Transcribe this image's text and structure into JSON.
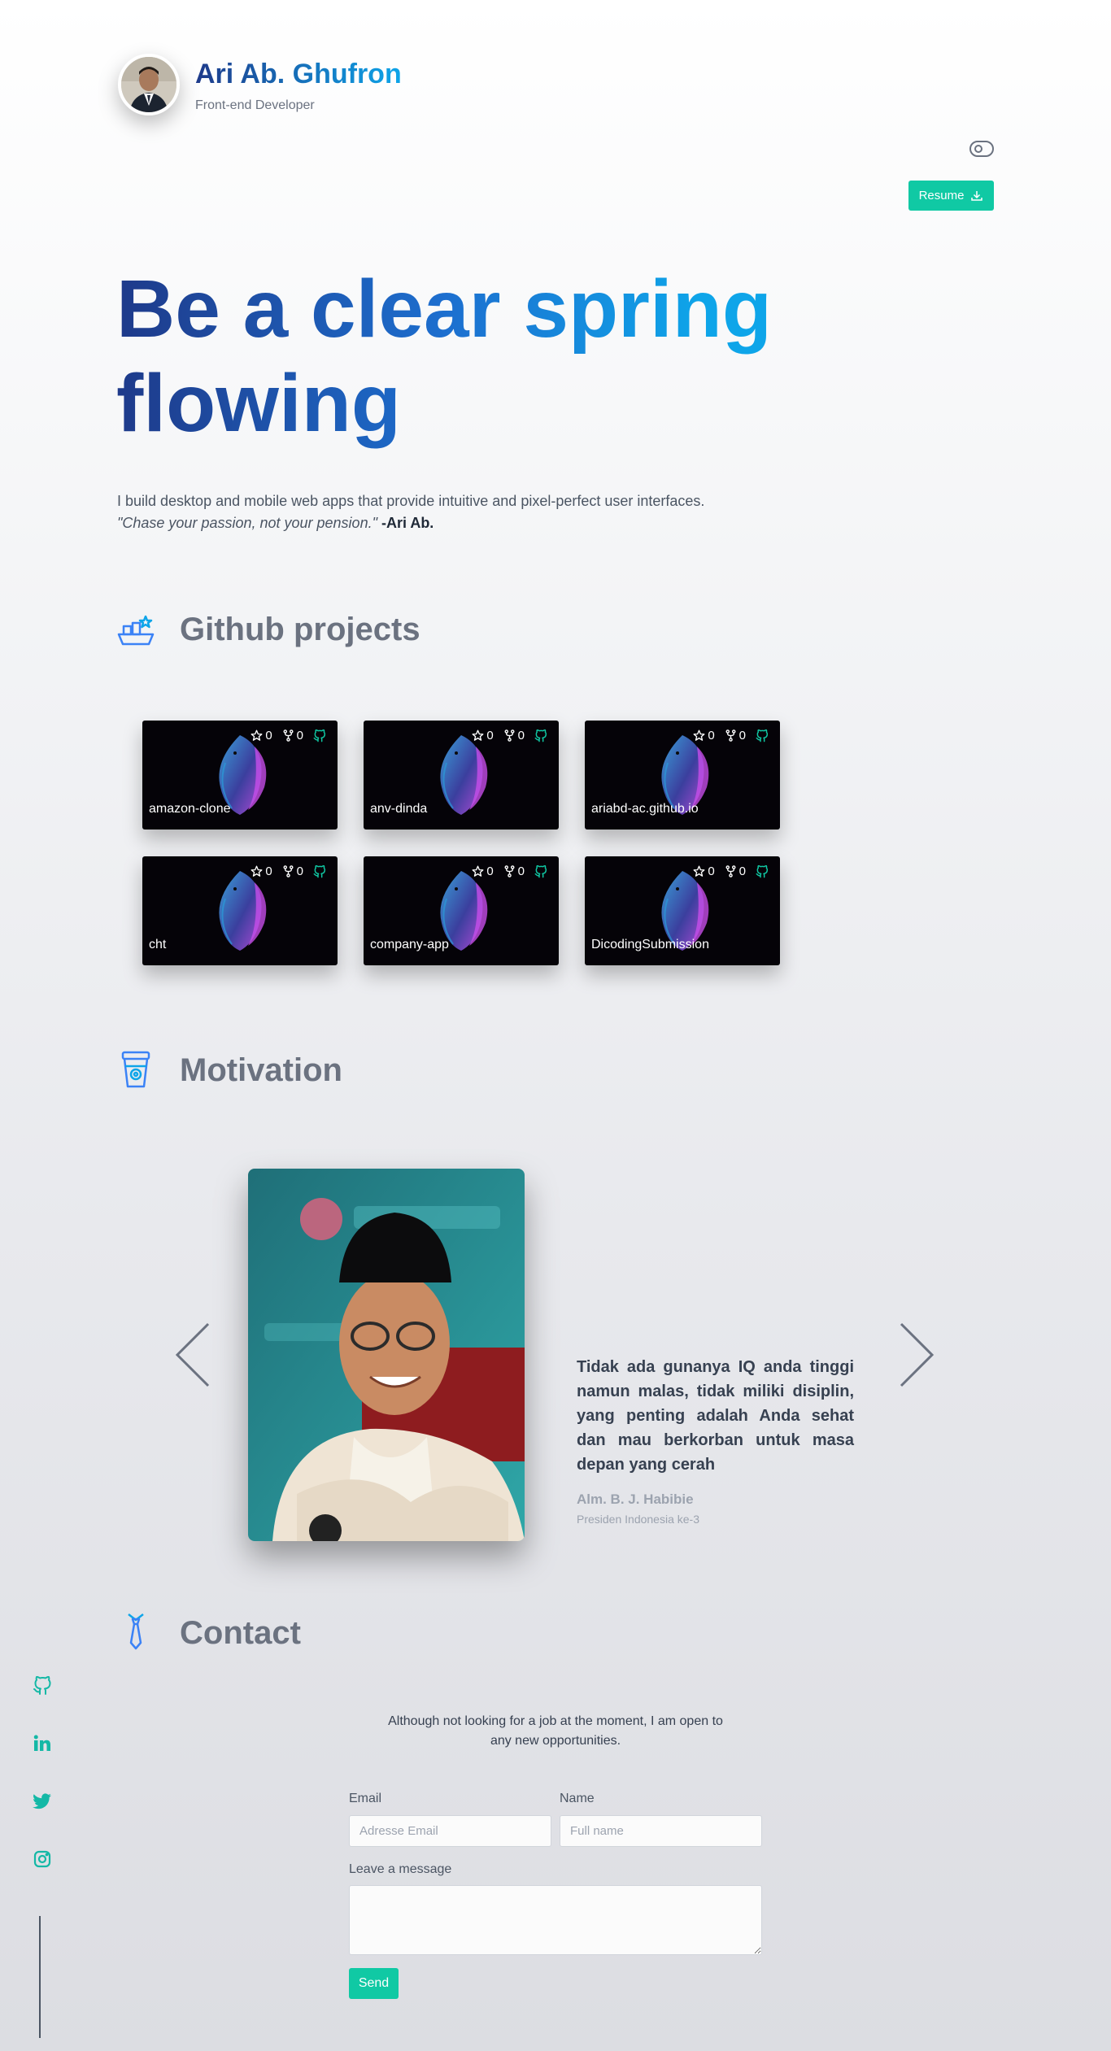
{
  "header": {
    "name_first": "Ari",
    "name_rest": "Ab. Ghufron",
    "subtitle": "Front-end Developer",
    "resume_label": "Resume",
    "avatar_icon": "profile-photo"
  },
  "hero": {
    "line1": "Be a clear spring",
    "line2": "flowing",
    "intro": "I build desktop and mobile web apps that provide intuitive and pixel-perfect user interfaces.",
    "quote": "\"Chase your passion, not your pension.\"",
    "quote_author": "-Ari Ab."
  },
  "github": {
    "title": "Github projects",
    "icon": "ship-star-icon",
    "projects": [
      {
        "name": "amazon-clone",
        "stars": "0",
        "forks": "0"
      },
      {
        "name": "anv-dinda",
        "stars": "0",
        "forks": "0"
      },
      {
        "name": "ariabd-ac.github.io",
        "stars": "0",
        "forks": "0"
      },
      {
        "name": "cht",
        "stars": "0",
        "forks": "0"
      },
      {
        "name": "company-app",
        "stars": "0",
        "forks": "0"
      },
      {
        "name": "DicodingSubmission",
        "stars": "0",
        "forks": "0"
      }
    ]
  },
  "motivation": {
    "title": "Motivation",
    "icon": "coffee-cup-icon",
    "quote": "Tidak ada gunanya IQ anda tinggi namun malas, tidak miliki disiplin, yang penting adalah Anda sehat dan mau berkorban untuk masa depan yang cerah",
    "author": "Alm. B. J. Habibie",
    "role": "Presiden Indonesia ke-3"
  },
  "contact": {
    "title": "Contact",
    "icon": "necktie-icon",
    "intro": "Although not looking for a job at the moment, I am open to any new opportunities.",
    "email_label": "Email",
    "email_placeholder": "Adresse Email",
    "name_label": "Name",
    "name_placeholder": "Full name",
    "message_label": "Leave a message",
    "send_label": "Send"
  },
  "social": [
    "github-icon",
    "linkedin-icon",
    "twitter-icon",
    "instagram-icon"
  ],
  "colors": {
    "accent": "#10c9a4",
    "brand_dark": "#1e3a8a",
    "brand_light": "#0ea5e9",
    "muted": "#6b7280"
  }
}
